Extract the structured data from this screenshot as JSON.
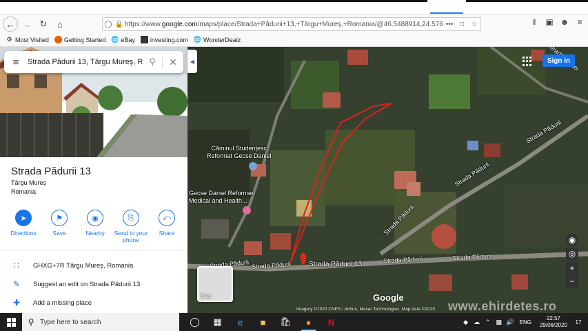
{
  "browser": {
    "url_prefix": "https://www.",
    "url_domain": "google.com",
    "url_rest": "/maps/place/Strada+Pădurii+13,+Târgu+Mureș,+Romania/@46.5488914,24.5769831",
    "more_label": "•••",
    "bookmarks": [
      {
        "label": "Most Visited",
        "icon": "gear-icon"
      },
      {
        "label": "Getting Started",
        "icon": "firefox-icon"
      },
      {
        "label": "eBay",
        "icon": "globe-icon"
      },
      {
        "label": "investing.com",
        "icon": "investing-icon"
      },
      {
        "label": "WonderDealz",
        "icon": "globe-icon"
      }
    ]
  },
  "search": {
    "query": "Strada Pădurii 13, Târgu Mureș, Ro"
  },
  "place": {
    "title": "Strada Pădurii 13",
    "city": "Târgu Mureș",
    "country": "Romania"
  },
  "actions": [
    {
      "label": "Directions",
      "icon": "directions-icon"
    },
    {
      "label": "Save",
      "icon": "bookmark-icon"
    },
    {
      "label": "Nearby",
      "icon": "nearby-icon"
    },
    {
      "label": "Send to your phone",
      "icon": "send-to-phone-icon"
    },
    {
      "label": "Share",
      "icon": "share-icon"
    }
  ],
  "info": [
    {
      "text": "GHXG+7R Târgu Mureș, Romania",
      "icon": "plus-code-icon"
    },
    {
      "text": "Suggest an edit on Strada Pădurii 13",
      "icon": "pencil-icon"
    },
    {
      "text": "Add a missing place",
      "icon": "add-place-icon"
    }
  ],
  "map": {
    "sign_in": "Sign in",
    "poi_1": "Căminul Studențesc\nReformat Gecse Daniel",
    "poi_2": "Gecse Daniel Reformed\nMedical and Health...",
    "street_labels": [
      "Strada Pădurii",
      "Strada Pădurii",
      "Strada Pădurii",
      "Strada Pădurii 13",
      "Strada Pădurii",
      "Strada Pădurii",
      "Strada Pădurii",
      "Strada Pădurii",
      "Stradă Cantei"
    ],
    "minimap_label": "Map",
    "logo": "Google",
    "attribution": "Imagery ©2020 CNES / Airbus, Maxar Technologies, Map data ©2020",
    "watermark": "www.ehirdetes.ro",
    "accent": "#1a73e8",
    "boundary_color": "#e0201c"
  },
  "taskbar": {
    "search_placeholder": "Type here to search",
    "time": "22:57",
    "date": "29/06/2020",
    "lang": "ENG",
    "notif_count": "17"
  }
}
